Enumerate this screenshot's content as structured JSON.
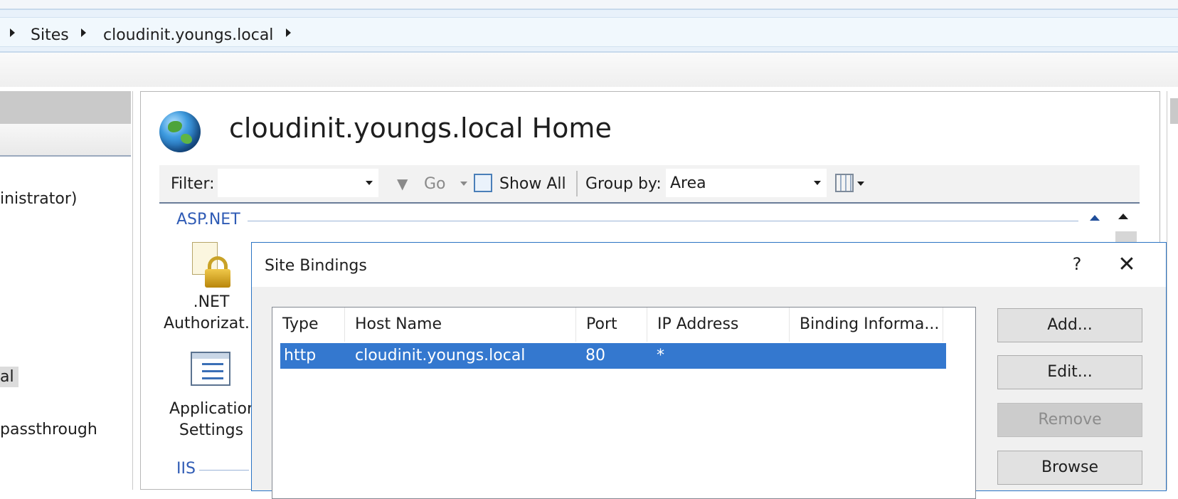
{
  "breadcrumb": {
    "items": [
      "Sites",
      "cloudinit.youngs.local"
    ]
  },
  "connections": {
    "items": [
      "inistrator)",
      "al",
      "passthrough"
    ]
  },
  "main": {
    "title": "cloudinit.youngs.local Home",
    "filter": {
      "filter_label": "Filter:",
      "filter_value": "",
      "go_label": "Go",
      "show_all_label": "Show All",
      "group_by_label": "Group by:",
      "group_by_value": "Area"
    },
    "groups": {
      "aspnet": "ASP.NET",
      "iis": "IIS"
    },
    "features": {
      "net_authorization": [
        ".NET",
        "Authorizat..."
      ],
      "application_settings": [
        "Applicatior",
        "Settings"
      ]
    }
  },
  "dialog": {
    "title": "Site Bindings",
    "help": "?",
    "close": "✕",
    "columns": [
      "Type",
      "Host Name",
      "Port",
      "IP Address",
      "Binding Informa..."
    ],
    "rows": [
      {
        "type": "http",
        "host": "cloudinit.youngs.local",
        "port": "80",
        "ip": "*",
        "info": ""
      }
    ],
    "buttons": {
      "add": "Add...",
      "edit": "Edit...",
      "remove": "Remove",
      "browse": "Browse"
    }
  },
  "colors": {
    "selection": "#3478cf",
    "dialog_border": "#2b74c4",
    "group_header": "#2f5bb5"
  }
}
